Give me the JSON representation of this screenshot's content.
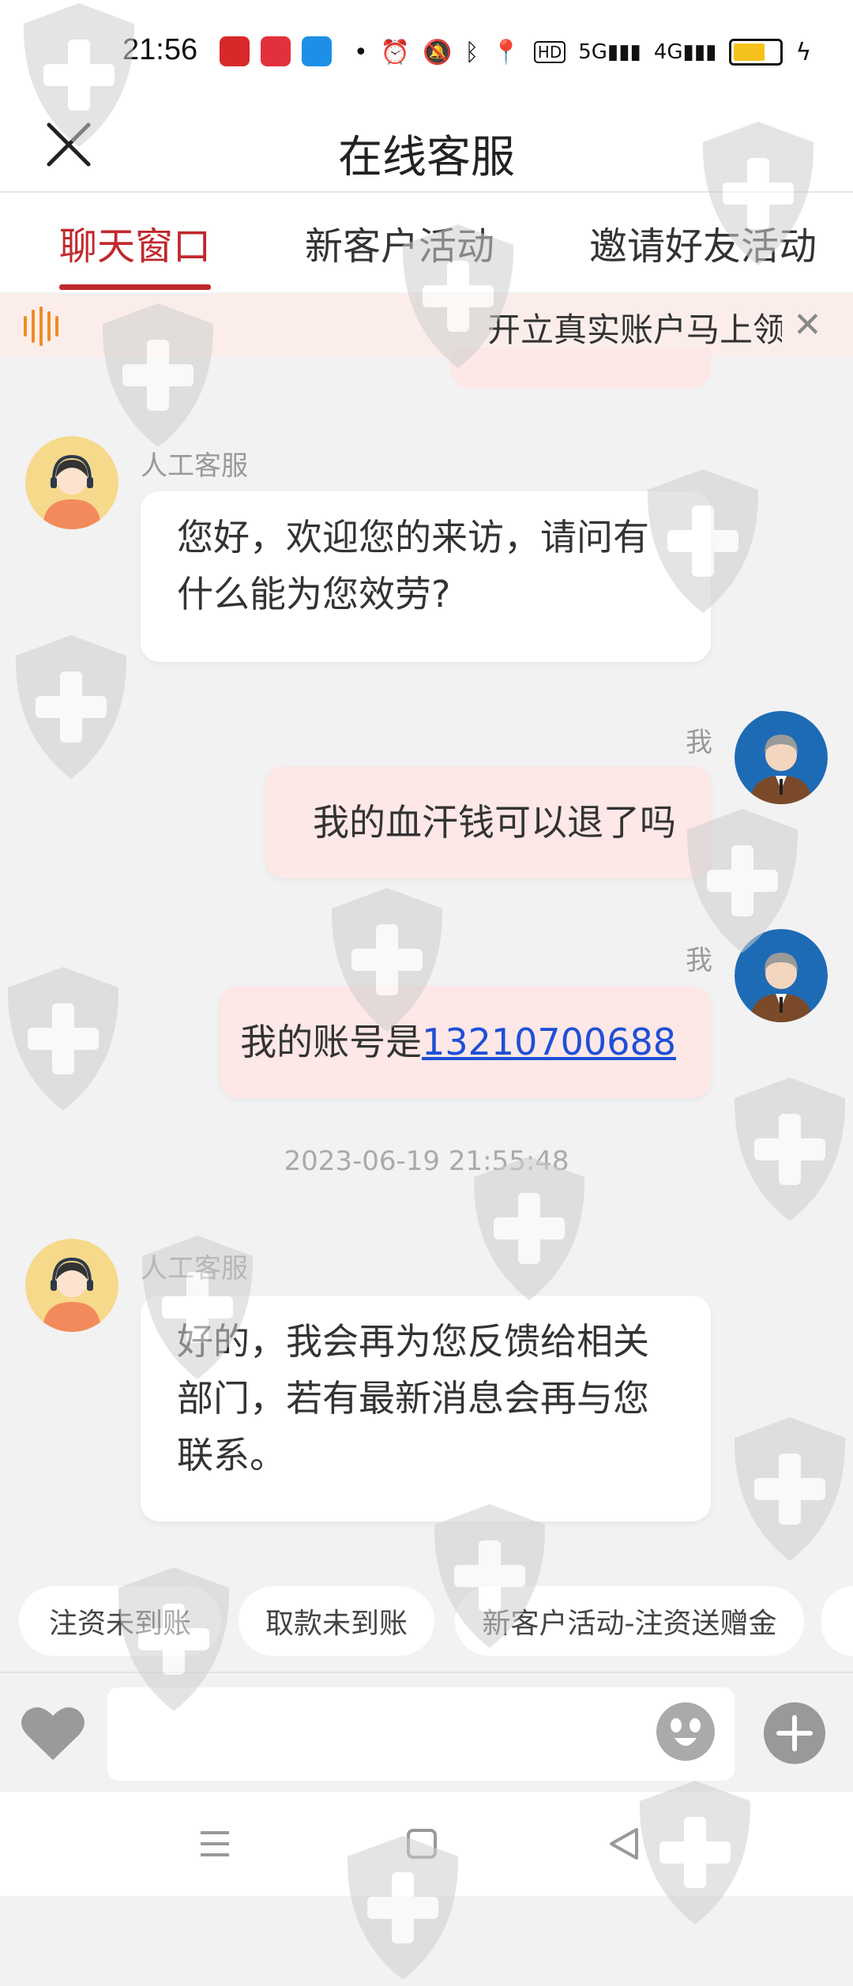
{
  "status_bar": {
    "time": "21:56",
    "icons": [
      "app-icon-red",
      "app-icon-618",
      "app-icon-blue",
      "dot",
      "alarm-icon",
      "mute-icon",
      "bluetooth-icon",
      "location-icon",
      "hd-icon",
      "5g-signal-icon",
      "4g-signal-icon",
      "battery-icon",
      "charging-icon"
    ],
    "battery_level": 0.75
  },
  "header": {
    "title": "在线客服"
  },
  "tabs": [
    {
      "label": "聊天窗口",
      "active": true
    },
    {
      "label": "新客户活动",
      "active": false
    },
    {
      "label": "邀请好友活动",
      "active": false
    }
  ],
  "notice": {
    "text": "开立真实账户马上领"
  },
  "messages": [
    {
      "sender": "人工客服",
      "side": "agent",
      "lines": [
        "您好，欢迎您的来访，请问有",
        "什么能为您效劳?"
      ]
    },
    {
      "sender": "我",
      "side": "me",
      "text": "我的血汗钱可以退了吗"
    },
    {
      "sender": "我",
      "side": "me",
      "text": "我的账号是",
      "link": "13210700688"
    },
    {
      "timestamp": "2023-06-19 21:55:48"
    },
    {
      "sender": "人工客服",
      "side": "agent",
      "lines": [
        "好的，我会再为您反馈给相关",
        "部门，若有最新消息会再与您",
        "联系。"
      ]
    }
  ],
  "quick_replies": [
    "注资未到账",
    "取款未到账",
    "新客户活动-注资送赠金"
  ],
  "input": {
    "placeholder": ""
  },
  "colors": {
    "accent": "#c0282d",
    "bubble_me": "#fde7e7",
    "link": "#1f4fd6",
    "background": "#f2f2f2"
  }
}
